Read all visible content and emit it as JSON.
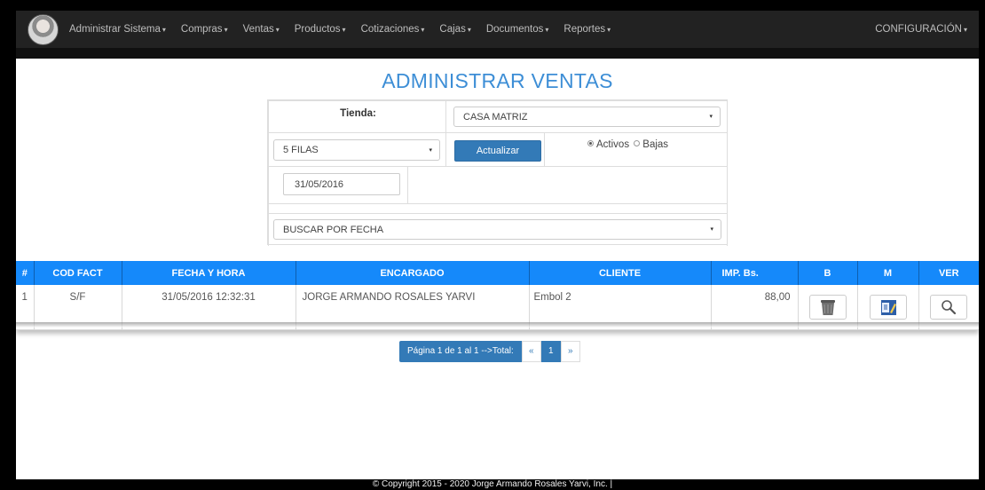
{
  "navbar": {
    "items": [
      {
        "label": "Administrar Sistema"
      },
      {
        "label": "Compras"
      },
      {
        "label": "Ventas"
      },
      {
        "label": "Productos"
      },
      {
        "label": "Cotizaciones"
      },
      {
        "label": "Cajas"
      },
      {
        "label": "Documentos"
      },
      {
        "label": "Reportes"
      }
    ],
    "caret": "▾",
    "config_label": "CONFIGURACIÓN"
  },
  "page": {
    "title": "ADMINISTRAR VENTAS"
  },
  "form": {
    "tienda_label": "Tienda:",
    "tienda_value": "CASA MATRIZ",
    "filas_value": "5 FILAS",
    "actualizar_label": "Actualizar",
    "radio_activos": "Activos",
    "radio_bajas": "Bajas",
    "radio_selected": "Activos",
    "fecha_value": "31/05/2016",
    "buscar_value": "BUSCAR POR FECHA",
    "select_arrow": "▾"
  },
  "table": {
    "headers": [
      "#",
      "COD FACT",
      "FECHA Y HORA",
      "ENCARGADO",
      "CLIENTE",
      "IMP. Bs.",
      "B",
      "M",
      "VER"
    ],
    "rows": [
      {
        "num": "1",
        "cod_fact": "S/F",
        "fecha_hora": "31/05/2016 12:32:31",
        "encargado": "JORGE ARMANDO ROSALES YARVI",
        "cliente": "Embol 2",
        "importe": "88,00"
      }
    ]
  },
  "pager": {
    "info": "Página 1 de 1 al 1 -->Total:",
    "prev": "«",
    "current": "1",
    "next": "»"
  },
  "footer": {
    "text": "© Copyright 2015 - 2020 Jorge Armando Rosales Yarvi, Inc. |"
  },
  "colors": {
    "navbar_bg": "#222222",
    "title": "#3d8ed6",
    "table_header": "#1589fa",
    "primary_button": "#337ab7"
  },
  "icons": {
    "delete": "trash-icon",
    "modify": "edit-document-icon",
    "view": "search-icon"
  }
}
